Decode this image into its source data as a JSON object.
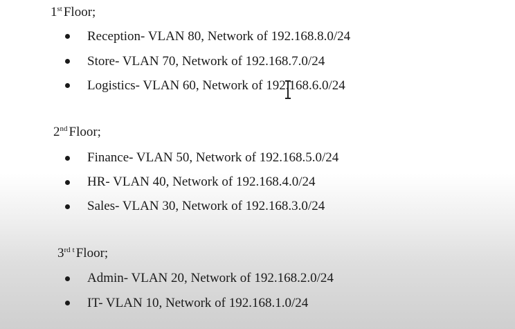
{
  "floors": [
    {
      "number": "1",
      "suffix": "st",
      "suffix_extra": "",
      "label": "Floor;",
      "items": [
        "Reception- VLAN 80, Network of 192.168.8.0/24",
        "Store- VLAN 70, Network of 192.168.7.0/24",
        "Logistics- VLAN 60, Network of 192.168.6.0/24"
      ]
    },
    {
      "number": "2",
      "suffix": "nd",
      "suffix_extra": "",
      "label": "Floor;",
      "items": [
        "Finance- VLAN 50, Network of 192.168.5.0/24",
        "HR- VLAN 40, Network of 192.168.4.0/24",
        "Sales- VLAN 30, Network of 192.168.3.0/24"
      ]
    },
    {
      "number": "3",
      "suffix": "rd",
      "suffix_extra": "t",
      "label": "Floor;",
      "items": [
        "Admin- VLAN 20, Network of 192.168.2.0/24",
        "IT- VLAN 10, Network of 192.168.1.0/24"
      ]
    }
  ],
  "cursor": "text-cursor-icon"
}
